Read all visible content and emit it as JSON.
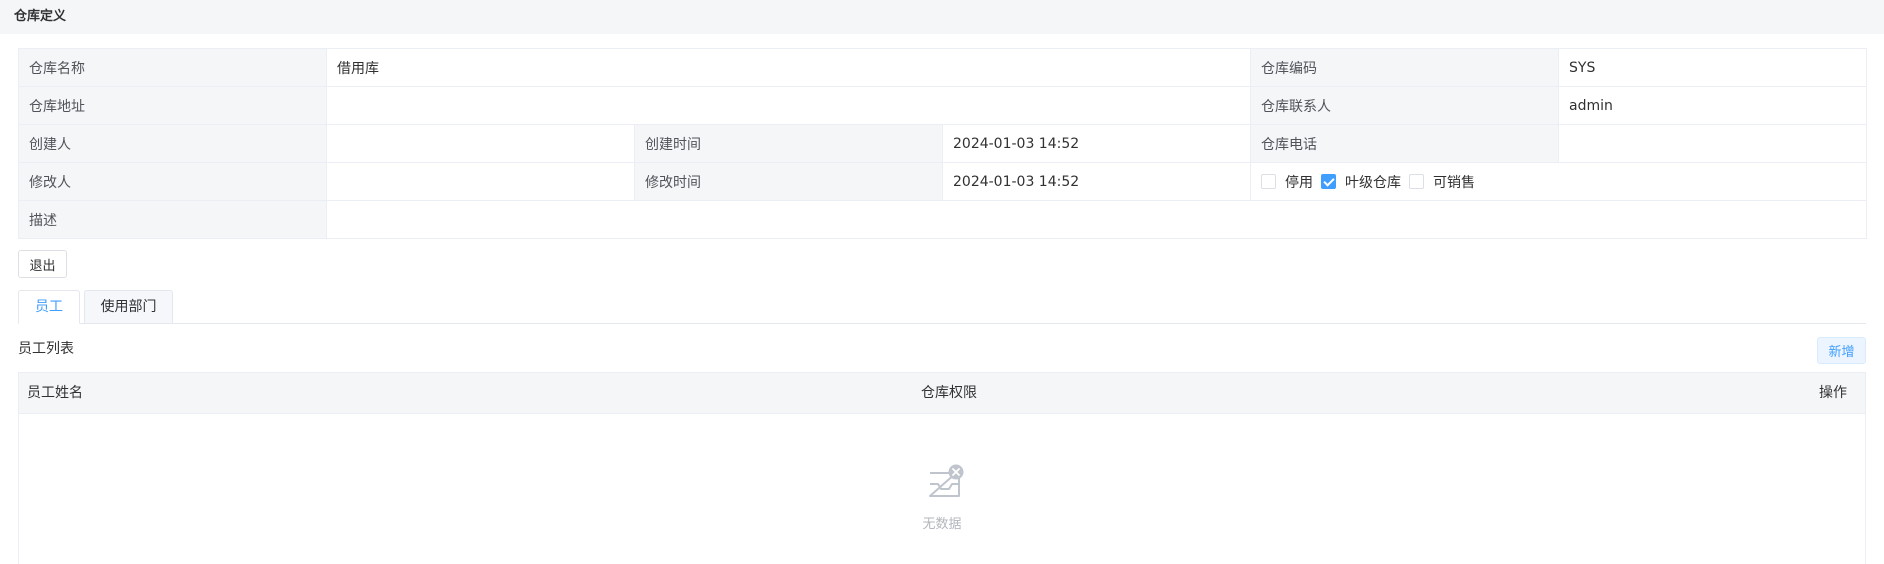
{
  "header": {
    "title": "仓库定义"
  },
  "form": {
    "warehouse_name_label": "仓库名称",
    "warehouse_name": "借用库",
    "warehouse_code_label": "仓库编码",
    "warehouse_code": "SYS",
    "warehouse_address_label": "仓库地址",
    "warehouse_address": "",
    "contact_label": "仓库联系人",
    "contact": "admin",
    "creator_label": "创建人",
    "creator": "",
    "create_time_label": "创建时间",
    "create_time": "2024-01-03 14:52",
    "phone_label": "仓库电话",
    "phone": "",
    "modifier_label": "修改人",
    "modifier": "",
    "modify_time_label": "修改时间",
    "modify_time": "2024-01-03 14:52",
    "description_label": "描述",
    "description": "",
    "flags": {
      "disabled_label": "停用",
      "disabled_checked": false,
      "leaf_label": "叶级仓库",
      "leaf_checked": true,
      "sellable_label": "可销售",
      "sellable_checked": false
    }
  },
  "actions": {
    "exit_label": "退出",
    "add_label": "新增"
  },
  "tabs": [
    {
      "label": "员工",
      "active": true
    },
    {
      "label": "使用部门",
      "active": false
    }
  ],
  "employee_list": {
    "title": "员工列表",
    "columns": [
      "员工姓名",
      "仓库权限",
      "操作"
    ],
    "rows": [],
    "empty_text": "无数据"
  },
  "colors": {
    "accent": "#409eff",
    "label_bg": "#f5f6f8",
    "border": "#ebeef5"
  }
}
